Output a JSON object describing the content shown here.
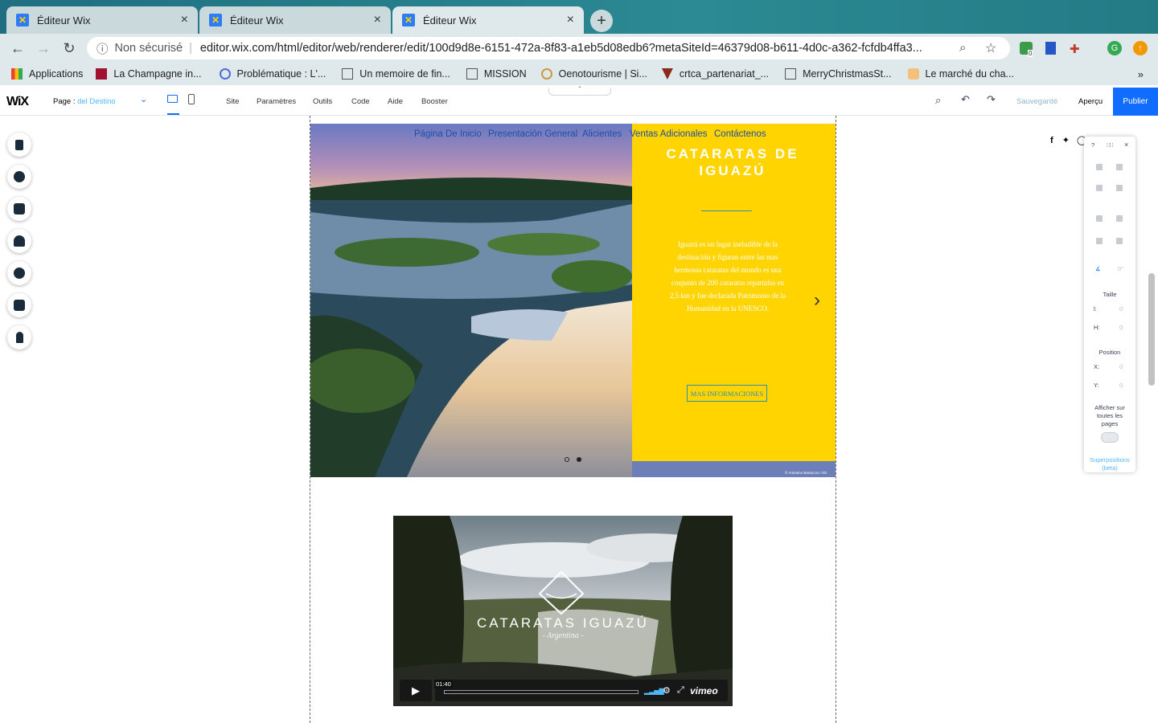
{
  "browser": {
    "tabs": [
      {
        "title": "Éditeur Wix"
      },
      {
        "title": "Éditeur Wix"
      },
      {
        "title": "Éditeur Wix"
      }
    ],
    "security": "Non sécurisé",
    "url": "editor.wix.com/html/editor/web/renderer/edit/100d9d8e-6151-472a-8f83-a1eb5d08edb6?metaSiteId=46379d08-b611-4d0c-a362-fcfdb4ffa3...",
    "extension_badge": "0",
    "bookmarks": [
      {
        "label": "Applications"
      },
      {
        "label": "La Champagne in..."
      },
      {
        "label": "Problématique : L'..."
      },
      {
        "label": "Un memoire de fin..."
      },
      {
        "label": "MISSION"
      },
      {
        "label": "Oenotourisme | Si..."
      },
      {
        "label": "crtca_partenariat_..."
      },
      {
        "label": "MerryChristmasSt..."
      },
      {
        "label": "Le marché du cha..."
      }
    ]
  },
  "wix": {
    "logo": "WiX",
    "page_label": "Page :",
    "page_value": "del Destino",
    "menu": [
      "Site",
      "Paramètres",
      "Outils",
      "Code",
      "Aide",
      "Booster"
    ],
    "saved": "Sauvegardé",
    "preview": "Aperçu",
    "publish": "Publier"
  },
  "site": {
    "nav": [
      "Página De Inicio",
      "Presentación General",
      "Alicientes",
      "Ventas Adicionales",
      "Contáctenos"
    ],
    "hero_title": "CATARATAS DE IGUAZÚ",
    "hero_text": "Iguazú es un lugar ineludible de la destinación y figuran entre las mas hermosas cataratas del mundo es una conjunto de 200 cataratas repartidas en 2,5 km y fue declarada Patrimonio de la Humanidad en la UNESCO.",
    "hero_button": "MAS INFORMACIONES",
    "credit": "© Antonino Bartuccio / SO",
    "video_title": "CATARATAS IGUAZÚ",
    "video_subtitle": "- Argentina -",
    "video_time": "01:40",
    "video_brand": "vimeo"
  },
  "panel": {
    "help": "?",
    "size_label": "Taille",
    "l_label": "l:",
    "h_label": "H:",
    "l_value": "0",
    "h_value": "0",
    "position_label": "Position",
    "x_label": "X:",
    "y_label": "Y:",
    "x_value": "0",
    "y_value": "0",
    "rotation": "0°",
    "show_all_pages": "Afficher sur toutes les pages",
    "overlays": "Superpositions (beta)"
  },
  "colors": {
    "accent": "#116dff",
    "hero_yellow": "#ffd400",
    "link": "#1e4ea8",
    "button_border": "#2d8fb5"
  }
}
